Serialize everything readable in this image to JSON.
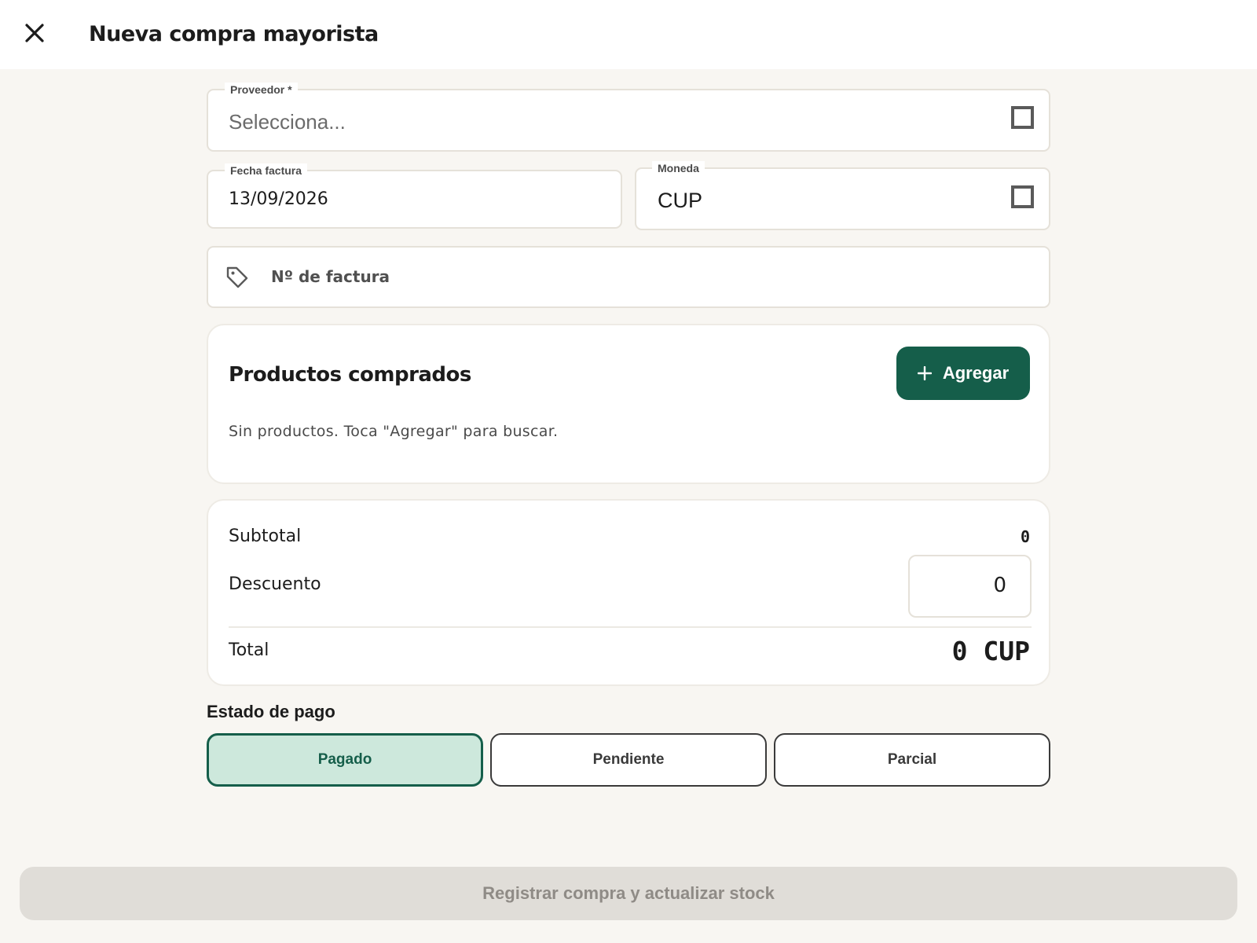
{
  "header": {
    "close_icon": "close-icon",
    "title": "Nueva compra mayorista"
  },
  "form": {
    "proveedor": {
      "label": "Proveedor *",
      "placeholder": "Selecciona...",
      "icon": "square-icon"
    },
    "fecha_factura": {
      "label": "Fecha factura",
      "value": "13/09/2026"
    },
    "moneda": {
      "label": "Moneda",
      "value": "CUP",
      "icon": "square-icon"
    },
    "numero_factura": {
      "placeholder": "Nº de factura",
      "icon": "tag-icon"
    }
  },
  "productos": {
    "title": "Productos comprados",
    "add_label": "Agregar",
    "add_icon": "plus-icon",
    "empty_text": "Sin productos. Toca \"Agregar\" para buscar."
  },
  "resumen": {
    "subtotal_label": "Subtotal",
    "subtotal_value": "0",
    "descuento_label": "Descuento",
    "descuento_value": "0",
    "total_label": "Total",
    "total_value": "0 CUP"
  },
  "pago": {
    "title": "Estado de pago",
    "options": [
      {
        "label": "Pagado",
        "selected": true
      },
      {
        "label": "Pendiente",
        "selected": false
      },
      {
        "label": "Parcial",
        "selected": false
      }
    ]
  },
  "submit_label": "Registrar compra y actualizar stock",
  "colors": {
    "background": "#f8f6f2",
    "primary": "#155e4a",
    "selected_bg": "#cde8dc",
    "disabled_bg": "#e0ddd8"
  }
}
